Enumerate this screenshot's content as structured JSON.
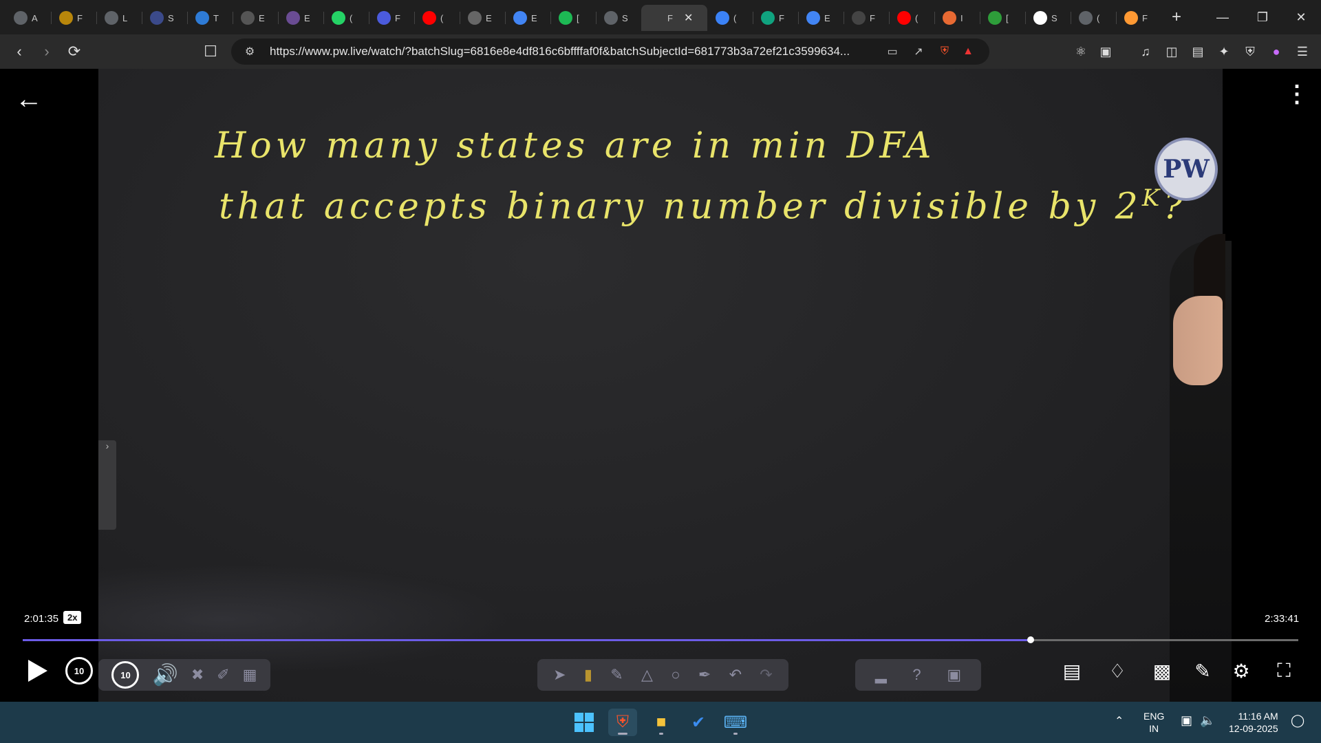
{
  "browser": {
    "tabs": [
      {
        "letter": "A",
        "color": "#5f6368",
        "icon": "chat-icon"
      },
      {
        "letter": "F",
        "color": "#b8860b",
        "icon": "coin-icon"
      },
      {
        "letter": "L",
        "color": "#5f6368",
        "icon": "globe-icon"
      },
      {
        "letter": "S",
        "color": "#3b4a8a",
        "icon": "site-icon"
      },
      {
        "letter": "T",
        "color": "#2e7bd6",
        "icon": "wp-icon"
      },
      {
        "letter": "E",
        "color": "#555555",
        "icon": "site-icon"
      },
      {
        "letter": "E",
        "color": "#6a4c93",
        "icon": "site-icon"
      },
      {
        "letter": "(",
        "color": "#25d366",
        "icon": "whatsapp-icon"
      },
      {
        "letter": "F",
        "color": "#4b5bdc",
        "icon": "site-icon"
      },
      {
        "letter": "(",
        "color": "#ff0000",
        "icon": "youtube-icon"
      },
      {
        "letter": "E",
        "color": "#666666",
        "icon": "site-icon"
      },
      {
        "letter": "E",
        "color": "#4285f4",
        "icon": "google-icon"
      },
      {
        "letter": "[",
        "color": "#1db954",
        "icon": "spotify-icon"
      },
      {
        "letter": "S",
        "color": "#5f6368",
        "icon": "globe-icon"
      },
      {
        "letter": "F",
        "color": "#3a3a3a",
        "icon": "pw-icon",
        "active": true
      },
      {
        "letter": "(",
        "color": "#3b82f6",
        "icon": "gemini-icon"
      },
      {
        "letter": "F",
        "color": "#10a37f",
        "icon": "openai-icon"
      },
      {
        "letter": "E",
        "color": "#4285f4",
        "icon": "google-icon"
      },
      {
        "letter": "F",
        "color": "#444444",
        "icon": "screen-icon"
      },
      {
        "letter": "(",
        "color": "#ff0000",
        "icon": "youtube-icon"
      },
      {
        "letter": "I",
        "color": "#e86a33",
        "icon": "site-icon"
      },
      {
        "letter": "[",
        "color": "#2e9d3a",
        "icon": "site-icon"
      },
      {
        "letter": "S",
        "color": "#ffffff",
        "icon": "wikipedia-icon"
      },
      {
        "letter": "(",
        "color": "#5f6368",
        "icon": "globe-icon"
      },
      {
        "letter": "F",
        "color": "#ff9933",
        "icon": "india-flag-icon"
      }
    ],
    "url": "https://www.pw.live/watch/?batchSlug=6816e8e4df816c6bffffaf0f&batchSubjectId=681773b3a72ef21c3599634..."
  },
  "player": {
    "board_line1": "How many states are in min DFA",
    "board_line2": "that accepts binary number divisible by 2",
    "board_superscript": "K",
    "board_end": "?",
    "logo": "PW",
    "current_time": "2:01:35",
    "speed": "2x",
    "total_time": "2:33:41",
    "progress_fraction": 0.79,
    "skip_back": "10",
    "skip_forward": "10",
    "accent": "#6c5ce7"
  },
  "taskbar": {
    "lang_top": "ENG",
    "lang_bottom": "IN",
    "time": "11:16 AM",
    "date": "12-09-2025"
  }
}
